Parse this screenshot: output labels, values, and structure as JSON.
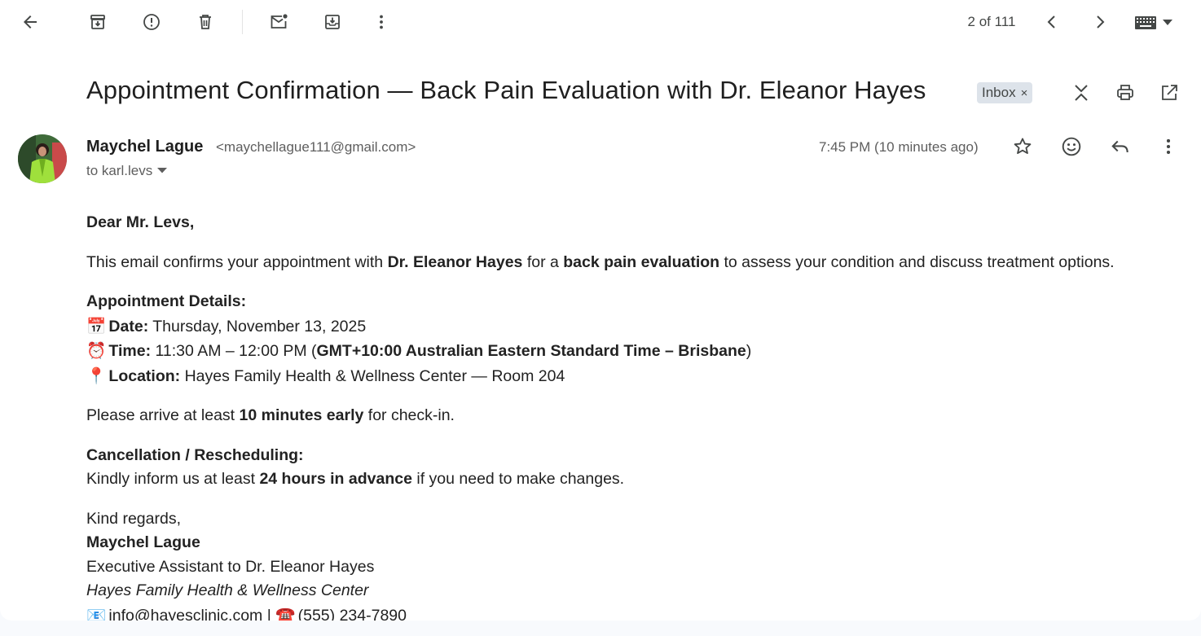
{
  "toolbar": {
    "back_icon": "arrow-left-icon",
    "archive_icon": "archive-icon",
    "spam_icon": "report-spam-icon",
    "delete_icon": "trash-icon",
    "mark_unread_icon": "mark-unread-icon",
    "move_icon": "move-to-icon",
    "more_icon": "more-vert-icon",
    "pager": "2 of 111",
    "prev_icon": "chevron-left-icon",
    "next_icon": "chevron-right-icon",
    "keyboard_icon": "keyboard-icon"
  },
  "subject": {
    "title": "Appointment Confirmation — Back Pain Evaluation with Dr. Eleanor Hayes",
    "label": "Inbox",
    "label_remove": "×"
  },
  "sender": {
    "name": "Maychel Lague",
    "email": "<maychellague111@gmail.com>",
    "to": "to karl.levs",
    "time": "7:45 PM (10 minutes ago)"
  },
  "body": {
    "greeting": "Dear Mr. Levs,",
    "intro_1": "This email confirms your appointment with ",
    "intro_doctor": "Dr. Eleanor Hayes",
    "intro_2": " for a ",
    "intro_purpose": "back pain evaluation",
    "intro_3": " to assess your condition and discuss treatment options.",
    "details_heading": "Appointment Details:",
    "date_emoji": "📅",
    "date_label": "Date:",
    "date_value": " Thursday, November 13, 2025",
    "time_emoji": "⏰",
    "time_label": "Time:",
    "time_value_1": " 11:30 AM – 12:00 PM (",
    "time_zone": "GMT+10:00 Australian Eastern Standard Time – Brisbane",
    "time_value_2": ")",
    "location_emoji": "📍",
    "location_label": "Location:",
    "location_value": " Hayes Family Health & Wellness Center — Room 204",
    "arrive_1": "Please arrive at least ",
    "arrive_bold": "10 minutes early",
    "arrive_2": " for check-in.",
    "cancel_heading": "Cancellation / Rescheduling:",
    "cancel_1": "Kindly inform us at least ",
    "cancel_bold": "24 hours in advance",
    "cancel_2": " if you need to make changes.",
    "closing": "Kind regards,",
    "sig_name": "Maychel Lague",
    "sig_title": "Executive Assistant to Dr. Eleanor Hayes",
    "sig_org": "Hayes Family Health & Wellness Center",
    "sig_email_emoji": "📧",
    "sig_email": "info@hayesclinic.com",
    "sig_sep": " | ",
    "sig_phone_emoji": "☎️",
    "sig_phone": "(555) 234-7890"
  }
}
